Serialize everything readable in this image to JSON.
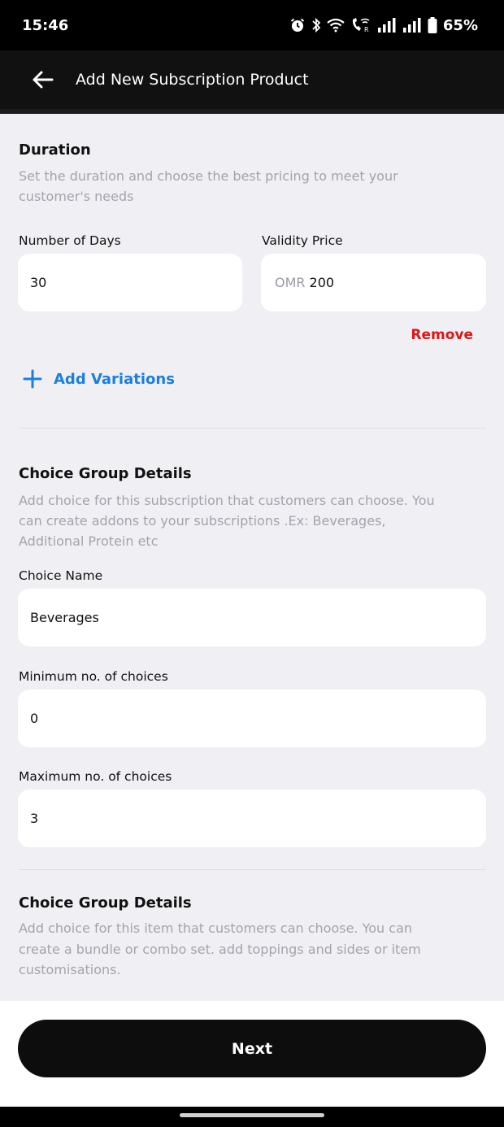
{
  "status_bar": {
    "time": "15:46",
    "battery": "65%",
    "icons": [
      "alarm-icon",
      "bluetooth-icon",
      "wifi-icon",
      "wifi-calling-icon",
      "signal-icon",
      "signal-icon",
      "battery-icon"
    ]
  },
  "app_bar": {
    "title": "Add New Subscription Product",
    "back_icon": "arrow-left-icon"
  },
  "duration": {
    "title": "Duration",
    "description_line1": "Set the duration and choose the best pricing to meet your",
    "description_line2": "customer's needs",
    "days_label": "Number of Days",
    "days_value": "30",
    "price_label": "Validity Price",
    "price_prefix": "OMR",
    "price_value": "200",
    "remove_label": "Remove",
    "add_variations_label": "Add Variations"
  },
  "choice_group_1": {
    "title": "Choice Group Details",
    "description_line1": "Add choice for this subscription that customers can choose. You",
    "description_line2": "can create addons to your subscriptions .Ex:  Beverages,",
    "description_line3": "Additional Protein etc",
    "name_label": "Choice Name",
    "name_value": "Beverages",
    "min_label": "Minimum no. of choices",
    "min_value": "0",
    "max_label": "Maximum no. of choices",
    "max_value": "3"
  },
  "choice_group_2": {
    "title": "Choice Group Details",
    "description_line1": "Add choice for this item that customers can choose. You can",
    "description_line2": "create a bundle or combo set. add toppings and sides or item",
    "description_line3": "customisations."
  },
  "footer": {
    "next_label": "Next"
  },
  "colors": {
    "accent_blue": "#1a7fe0",
    "remove_red": "#e01414",
    "background": "#f0f0f4",
    "header": "#111111"
  }
}
